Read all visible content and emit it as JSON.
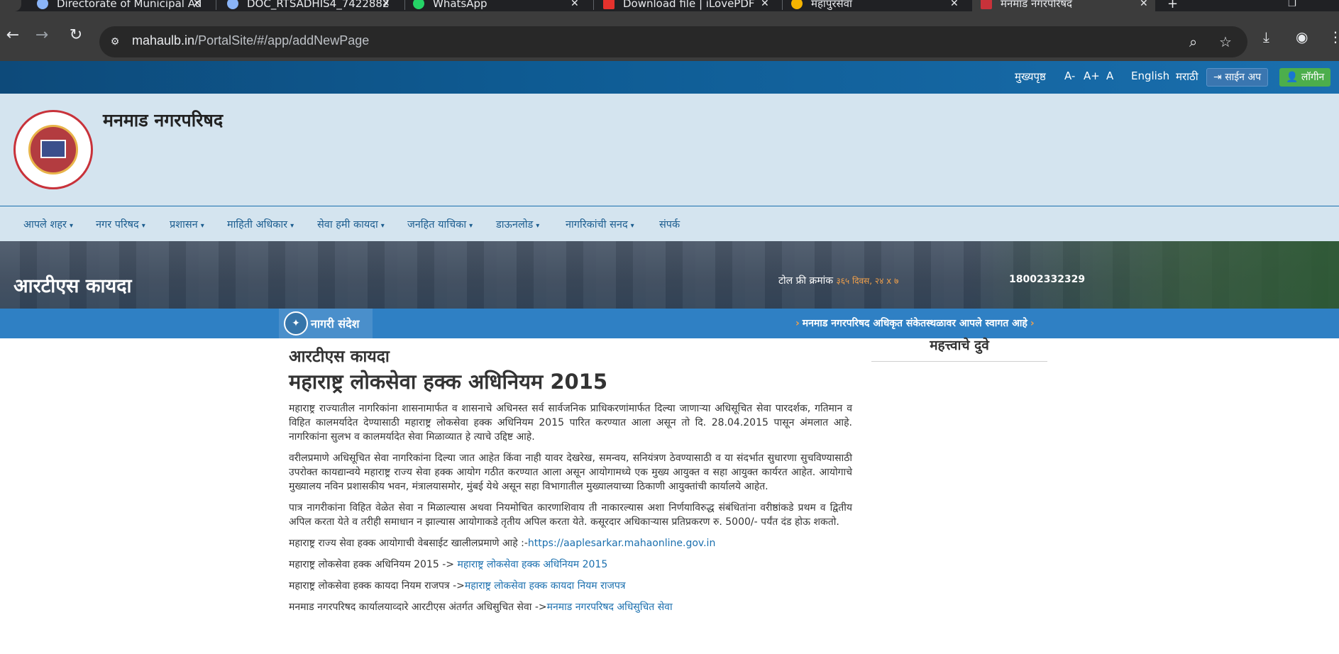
{
  "browser": {
    "tabs": [
      {
        "title": "Directorate of Municipal Ad",
        "favicon": "globe-icon"
      },
      {
        "title": "DOC_RTSADHIS4_7422882",
        "favicon": "globe-icon"
      },
      {
        "title": "WhatsApp",
        "favicon": "whatsapp-icon"
      },
      {
        "title": "Download file | iLovePDF",
        "favicon": "ilovepdf-icon"
      },
      {
        "title": "महापुरसेवा",
        "favicon": "coin-icon"
      },
      {
        "title": "मनमाड नगरपरिषद",
        "favicon": "site-logo-icon"
      }
    ],
    "url_host": "mahaulb.in",
    "url_path": "/PortalSite/#/app/addNewPage"
  },
  "topbar": {
    "home": "मुख्यपृष्ठ",
    "font_minus": "A-",
    "font_plus": "A+",
    "font_normal": "A",
    "lang_en": "English",
    "lang_mr": "मराठी",
    "signup": "साईन अप",
    "login": "लॉगीन"
  },
  "header": {
    "site_title": "मनमाड नगरपरिषद"
  },
  "nav": {
    "items": [
      {
        "label": "आपले शहर",
        "dropdown": true
      },
      {
        "label": "नगर परिषद",
        "dropdown": true
      },
      {
        "label": "प्रशासन",
        "dropdown": true
      },
      {
        "label": "माहिती अधिकार",
        "dropdown": true
      },
      {
        "label": "सेवा हमी कायदा",
        "dropdown": true
      },
      {
        "label": "जनहित याचिका",
        "dropdown": true
      },
      {
        "label": "डाऊनलोड",
        "dropdown": true
      },
      {
        "label": "नागरिकांची सनद",
        "dropdown": true
      },
      {
        "label": "संपर्क",
        "dropdown": false
      }
    ]
  },
  "banner": {
    "page_title": "आरटीएस कायदा",
    "tollfree_label": "टोल फ्री क्रमांक",
    "tollfree_sub": "३६५ दिवस, २४ x ७",
    "phone": "18002332329"
  },
  "ticker": {
    "label": "नागरी संदेश",
    "message": "मनमाड नगरपरिषद अधिकृत संकेतस्थळावर आपले स्वागत आहे"
  },
  "content": {
    "heading_small": "आरटीएस कायदा",
    "heading_big": "महाराष्ट्र लोकसेवा हक्क अधिनियम 2015",
    "paragraphs": [
      "महाराष्ट्र राज्यातील नागरिकांना शासनामार्फत व शासनाचे अधिनस्त सर्व सार्वजनिक प्राधिकरणांमार्फत दिल्या जाणाऱ्या अधिसूचित सेवा पारदर्शक, गतिमान व विहित कालमर्यादेत देण्यासाठी महाराष्ट्र लोकसेवा हक्क अधिनियम 2015 पारित करण्यात आला असून तो दि. 28.04.2015 पासून अंमलात आहे. नागरिकांना सुलभ व कालमर्यादेत सेवा मिळाव्यात हे त्याचे उद्दिष्ट आहे.",
      "वरीलप्रमाणे अधिसूचित सेवा नागरिकांना दिल्या जात आहेत किंवा नाही यावर देखरेख, समन्वय, सनियंत्रण ठेवण्यासाठी व या संदर्भात सुधारणा सुचविण्यासाठी उपरोक्त कायद्यान्वये महाराष्ट्र राज्य सेवा हक्क आयोग गठीत करण्यात आला असून आयोगामध्ये एक मुख्य आयुक्त व सहा आयुक्त कार्यरत आहेत. आयोगाचे मुख्यालय नविन प्रशासकीय भवन, मंत्रालयासमोर, मुंबई येथे असून सहा विभागातील मुख्यालयाच्या ठिकाणी आयुक्तांची कार्यालये आहेत.",
      "पात्र नागरीकांना विहित वेळेत सेवा न मिळाल्यास अथवा नियमोचित कारणाशिवाय ती नाकारल्यास अशा निर्णयाविरुद्ध संबंधितांना वरीष्ठांकडे प्रथम व द्वितीय अपिल करता येते व तरीही समाधान न झाल्यास आयोगाकडे तृतीय अपिल करता येते. कसूरदार अधिकाऱ्यास प्रतिप्रकरण रु. 5000/- पर्यंत दंड होऊ शकतो."
    ],
    "links": [
      {
        "prefix": "महाराष्ट्र राज्य सेवा हक्क आयोगाची वेबसाईट खालीलप्रमाणे आहे :-",
        "link": "https://aaplesarkar.mahaonline.gov.in"
      },
      {
        "prefix": "महाराष्ट्र लोकसेवा हक्क अधिनियम 2015 -> ",
        "link": "महाराष्ट्र लोकसेवा हक्क अधिनियम 2015"
      },
      {
        "prefix": "महाराष्ट्र लोकसेवा हक्क कायदा नियम राजपत्र ->",
        "link": "महाराष्ट्र लोकसेवा हक्क कायदा नियम राजपत्र"
      },
      {
        "prefix": "मनमाड नगरपरिषद कार्यालयाव्दारे आरटीएस अंतर्गत अधिसुचित सेवा ->",
        "link": "मनमाड नगरपरिषद अधिसुचित सेवा"
      }
    ]
  },
  "sidebar": {
    "title": "महत्त्वाचे दुवे"
  },
  "colors": {
    "topbar_blue": "#0e5b93",
    "header_bg": "#d4e4ef",
    "nav_text": "#1a5c8f",
    "ticker_blue": "#2f80c4",
    "login_green": "#4cae4c",
    "accent_orange": "#f0a04b",
    "link_blue": "#1a6fae"
  }
}
